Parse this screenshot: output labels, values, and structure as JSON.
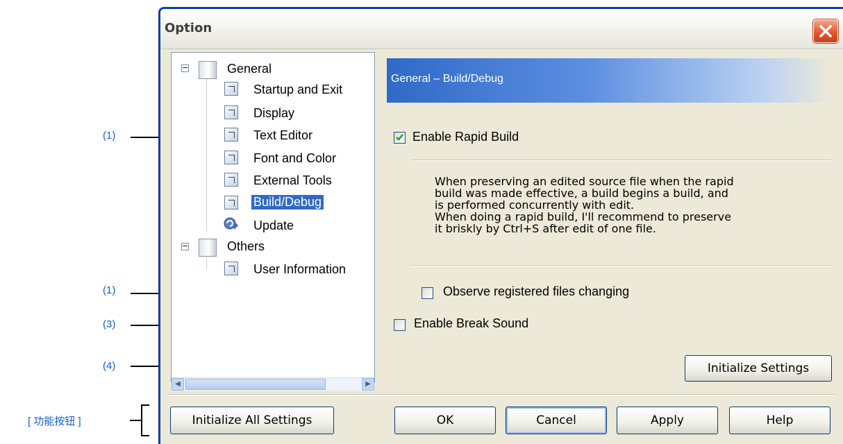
{
  "window": {
    "title": "Option",
    "close_icon": "close-icon"
  },
  "tree": {
    "items": [
      {
        "label": "General",
        "type": "book"
      },
      {
        "label": "Startup and Exit",
        "type": "page"
      },
      {
        "label": "Display",
        "type": "page"
      },
      {
        "label": "Text Editor",
        "type": "page"
      },
      {
        "label": "Font and Color",
        "type": "page"
      },
      {
        "label": "External Tools",
        "type": "page"
      },
      {
        "label": "Build/Debug",
        "type": "page",
        "selected": true
      },
      {
        "label": "Update",
        "type": "update"
      },
      {
        "label": "Others",
        "type": "book"
      },
      {
        "label": "User Information",
        "type": "page"
      }
    ]
  },
  "panel": {
    "header": "General – Build/Debug",
    "rapid_build": {
      "label": "Enable Rapid Build",
      "mnemonic": "R",
      "checked": true
    },
    "description": "When preserving an edited source file when the rapid\nbuild was made effective, a build begins a build, and\nis performed concurrently with edit.\nWhen doing a rapid build, I'll recommend to preserve\nit briskly by Ctrl+S after edit of one file.",
    "observe_files": {
      "label": "Observe registered files changing",
      "mnemonic": "O",
      "checked": false
    },
    "break_sound": {
      "label": "Enable Break Sound",
      "mnemonic": "B",
      "checked": false
    },
    "initialize_settings": "Initialize Settings"
  },
  "footer": {
    "initialize_all": "Initialize All Settings",
    "ok": "OK",
    "cancel": "Cancel",
    "apply": "Apply",
    "help": "Help"
  },
  "callouts": {
    "c1a": "(1)",
    "c1b": "(1)",
    "c3": "(3)",
    "c4": "(4)",
    "buttons": "[ 功能按钮 ]"
  },
  "colors": {
    "title_bar_border": "#0a3fa7",
    "selection": "#316ac5",
    "callout_text": "#1560c8"
  }
}
